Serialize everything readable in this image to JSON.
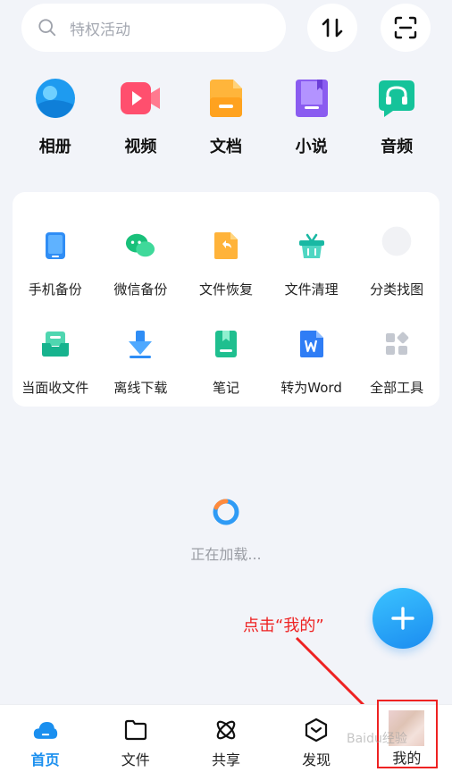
{
  "search": {
    "placeholder": "特权活动"
  },
  "quick_items": [
    {
      "label": "相册",
      "icon": "photo-album-icon"
    },
    {
      "label": "视频",
      "icon": "video-icon"
    },
    {
      "label": "文档",
      "icon": "document-icon"
    },
    {
      "label": "小说",
      "icon": "novel-book-icon"
    },
    {
      "label": "音频",
      "icon": "audio-headphone-icon"
    }
  ],
  "tools_row1": [
    {
      "label": "手机备份"
    },
    {
      "label": "微信备份"
    },
    {
      "label": "文件恢复"
    },
    {
      "label": "文件清理"
    },
    {
      "label": "分类找图"
    }
  ],
  "tools_row2": [
    {
      "label": "当面收文件"
    },
    {
      "label": "离线下载"
    },
    {
      "label": "笔记"
    },
    {
      "label": "转为Word"
    },
    {
      "label": "全部工具"
    }
  ],
  "loading": {
    "text": "正在加载..."
  },
  "annotation": {
    "text": "点击“我的”"
  },
  "nav": [
    {
      "label": "首页"
    },
    {
      "label": "文件"
    },
    {
      "label": "共享"
    },
    {
      "label": "发现"
    },
    {
      "label": "我的"
    }
  ],
  "watermark": {
    "text": "Baidu经验"
  },
  "colors": {
    "accent": "#1a8fef",
    "annotation": "#e22222",
    "background": "#f2f4f9"
  }
}
